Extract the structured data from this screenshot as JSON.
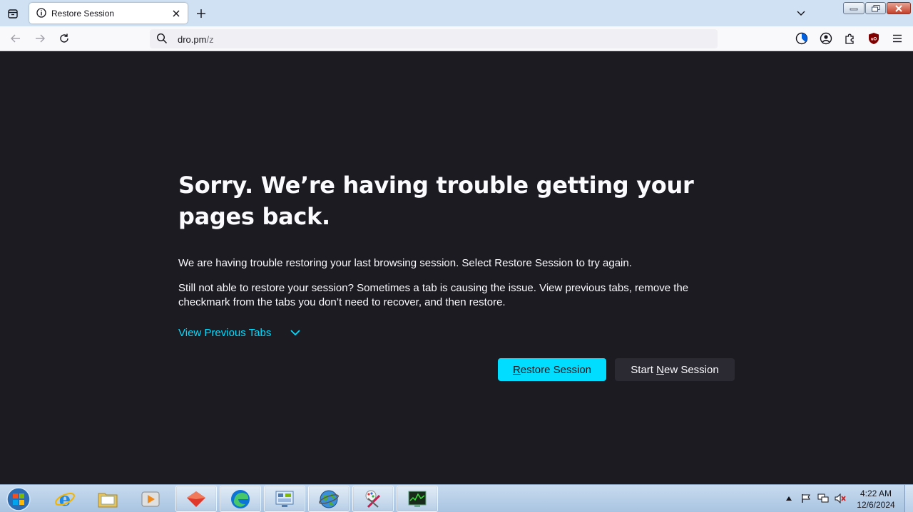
{
  "browser": {
    "tab": {
      "title": "Restore Session",
      "icon": "info-icon"
    },
    "urlbar": {
      "host": "dro.pm",
      "path": "/z"
    }
  },
  "content": {
    "heading": "Sorry. We’re having trouble getting your pages back.",
    "para1": "We are having trouble restoring your last browsing session. Select Restore Session to try again.",
    "para2": "Still not able to restore your session? Sometimes a tab is causing the issue. View previous tabs, remove the checkmark from the tabs you don’t need to recover, and then restore.",
    "view_previous": "View Previous Tabs",
    "restore_button": {
      "pre": "",
      "ul": "R",
      "post": "estore Session"
    },
    "new_session_button": {
      "pre": "Start ",
      "ul": "N",
      "post": "ew Session"
    }
  },
  "taskbar": {
    "apps": [
      "start-orb",
      "internet-explorer",
      "file-explorer",
      "media-player",
      "firefox",
      "edge",
      "control-panel",
      "network-globe",
      "paint",
      "task-manager"
    ],
    "clock": {
      "time": "4:22 AM",
      "date": "12/6/2024"
    }
  },
  "colors": {
    "accent": "#00ddff",
    "page_bg": "#1c1b22",
    "tabstrip": "#cfe1f3"
  }
}
